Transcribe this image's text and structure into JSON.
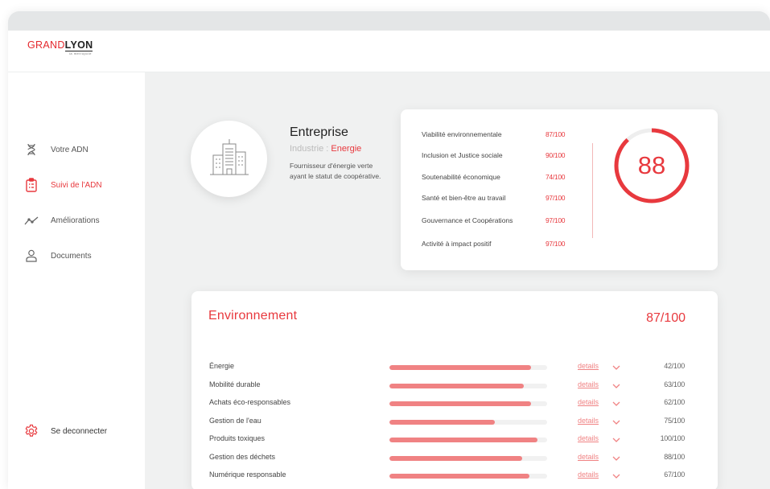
{
  "brand": {
    "main_prefix": "GRAND",
    "main_suffix": "LYON",
    "sub": "la métropole"
  },
  "nav": {
    "items": [
      {
        "label": "Votre ADN",
        "icon": "dna-icon",
        "active": false
      },
      {
        "label": "Suivi de l'ADN",
        "icon": "clipboard-icon",
        "active": true
      },
      {
        "label": "Améliorations",
        "icon": "trend-line-icon",
        "active": false
      },
      {
        "label": "Documents",
        "icon": "user-icon",
        "active": false
      }
    ],
    "logout_label": "Se deconnecter"
  },
  "company": {
    "title": "Entreprise",
    "industry_prefix": "Industrie : ",
    "industry_value": "Energie",
    "description": "Fournisseur d'énergie verte ayant le statut de coopérative."
  },
  "scores": {
    "rows": [
      {
        "label": "Viabilité environnementale",
        "value": "87/100"
      },
      {
        "label": "Inclusion et Justice sociale",
        "value": "90/100"
      },
      {
        "label": "Soutenabilité économique",
        "value": "74/100"
      },
      {
        "label": "Santé et bien-être au travail",
        "value": "97/100"
      },
      {
        "label": "Gouvernance et Coopérations",
        "value": "97/100"
      },
      {
        "label": "Activité à impact positif",
        "value": "97/100"
      }
    ],
    "overall": "88",
    "overall_fraction": 0.88
  },
  "environment": {
    "title": "Environnement",
    "total": "87/100",
    "details_label": "details",
    "rows": [
      {
        "label": "Énergie",
        "score": "42/100",
        "fill": 0.9
      },
      {
        "label": "Mobilité durable",
        "score": "63/100",
        "fill": 0.85
      },
      {
        "label": "Achats éco-responsables",
        "score": "62/100",
        "fill": 0.9
      },
      {
        "label": "Gestion de l'eau",
        "score": "75/100",
        "fill": 0.67
      },
      {
        "label": "Produits toxiques",
        "score": "100/100",
        "fill": 0.94
      },
      {
        "label": "Gestion des déchets",
        "score": "88/100",
        "fill": 0.84
      },
      {
        "label": "Numérique responsable",
        "score": "67/100",
        "fill": 0.89
      }
    ]
  },
  "colors": {
    "accent": "#e8393e",
    "bar": "#f08283"
  }
}
